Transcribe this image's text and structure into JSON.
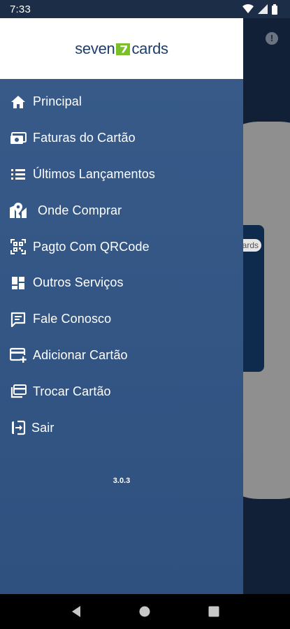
{
  "status_bar": {
    "time": "7:33"
  },
  "logo": {
    "left": "seven",
    "right": "cards"
  },
  "menu": [
    {
      "label": "Principal",
      "icon": "home-icon"
    },
    {
      "label": "Faturas do Cartão",
      "icon": "invoice-icon"
    },
    {
      "label": "Últimos Lançamentos",
      "icon": "list-icon"
    },
    {
      "label": "Onde Comprar",
      "icon": "map-pin-icon"
    },
    {
      "label": "Pagto Com QRCode",
      "icon": "qrcode-icon"
    },
    {
      "label": "Outros Serviços",
      "icon": "dashboard-icon"
    },
    {
      "label": "Fale Conosco",
      "icon": "chat-icon"
    },
    {
      "label": "Adicionar Cartão",
      "icon": "add-card-icon"
    },
    {
      "label": "Trocar Cartão",
      "icon": "switch-card-icon"
    },
    {
      "label": "Sair",
      "icon": "exit-icon"
    }
  ],
  "version": "3.0.3",
  "background": {
    "card_badge": "cards",
    "info": "!"
  },
  "colors": {
    "drawer": "#2f5180",
    "header": "#ffffff",
    "brand_blue": "#1f3f6b",
    "brand_green": "#7bbf2a"
  }
}
